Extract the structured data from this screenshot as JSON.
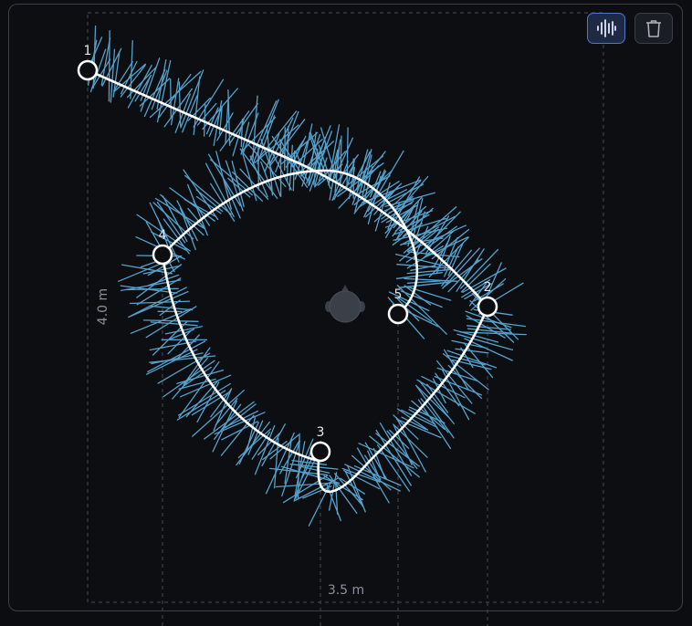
{
  "toolbar": {
    "waveform_icon": "waveform-icon",
    "trash_icon": "trash-icon"
  },
  "room": {
    "width_label": "3.5 m",
    "depth_label": "4.0 m"
  },
  "points": [
    {
      "label": "1"
    },
    {
      "label": "2"
    },
    {
      "label": "3"
    },
    {
      "label": "4"
    },
    {
      "label": "5"
    }
  ],
  "listener": {
    "icon": "listener-head-icon"
  },
  "colors": {
    "background": "#0b0d11",
    "ray": "#5aa9d6",
    "path": "#ffffff",
    "accent": "#4f76c9",
    "guide": "#3a4150"
  }
}
